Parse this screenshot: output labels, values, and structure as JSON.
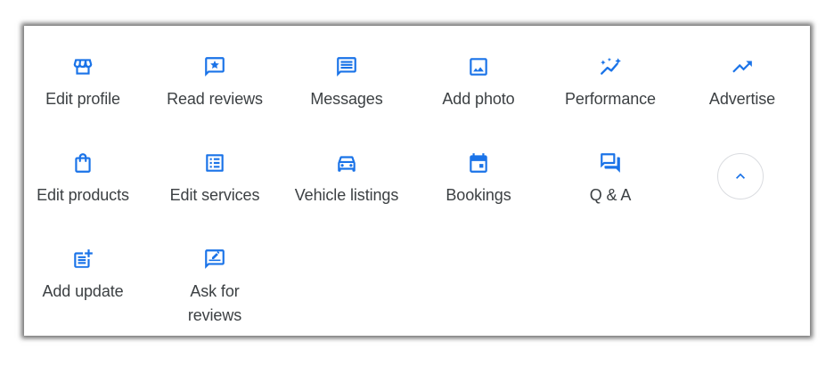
{
  "accent_color": "#1a73e8",
  "actions": [
    {
      "label": "Edit profile",
      "icon": "storefront-icon"
    },
    {
      "label": "Read reviews",
      "icon": "star-review-icon"
    },
    {
      "label": "Messages",
      "icon": "message-icon"
    },
    {
      "label": "Add photo",
      "icon": "image-icon"
    },
    {
      "label": "Performance",
      "icon": "sparkle-trend-icon"
    },
    {
      "label": "Advertise",
      "icon": "trending-up-icon"
    },
    {
      "label": "Edit products",
      "icon": "shopping-bag-icon"
    },
    {
      "label": "Edit services",
      "icon": "list-icon"
    },
    {
      "label": "Vehicle listings",
      "icon": "car-icon"
    },
    {
      "label": "Bookings",
      "icon": "calendar-icon"
    },
    {
      "label": "Q & A",
      "icon": "forum-icon"
    },
    {
      "label": "Add update",
      "icon": "post-add-icon"
    },
    {
      "label": "Ask for reviews",
      "icon": "rate-review-icon"
    }
  ],
  "collapse_button": {
    "icon": "chevron-up-icon"
  }
}
